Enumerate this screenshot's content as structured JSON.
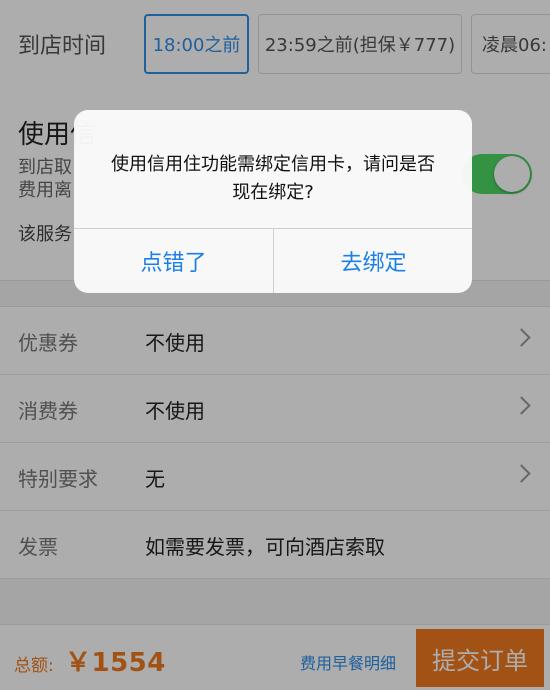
{
  "arrival": {
    "label": "到店时间",
    "options": [
      "18:00之前",
      "23:59之前(担保￥777)",
      "凌晨06:"
    ],
    "selected_index": 0
  },
  "credit": {
    "title": "使用信",
    "desc_line1": "到店取",
    "desc_line2": "费用离",
    "service_text": "该服务",
    "toggle_on": true
  },
  "list": [
    {
      "label": "优惠券",
      "value": "不使用",
      "chevron": true
    },
    {
      "label": "消费券",
      "value": "不使用",
      "chevron": true
    },
    {
      "label": "特别要求",
      "value": "无",
      "chevron": true
    },
    {
      "label": "发票",
      "value": "如需要发票，可向酒店索取",
      "chevron": false
    }
  ],
  "bottom": {
    "total_label": "总额:",
    "total_amount": "￥1554",
    "detail_link": "费用早餐明细",
    "submit": "提交订单"
  },
  "dialog": {
    "message_line1": "使用信用住功能需绑定信用卡，请问是否",
    "message_line2": "现在绑定?",
    "cancel": "点错了",
    "confirm": "去绑定"
  },
  "colors": {
    "accent_blue": "#2f8ee8",
    "toggle_green": "#4cd964",
    "orange": "#f07a1f"
  }
}
